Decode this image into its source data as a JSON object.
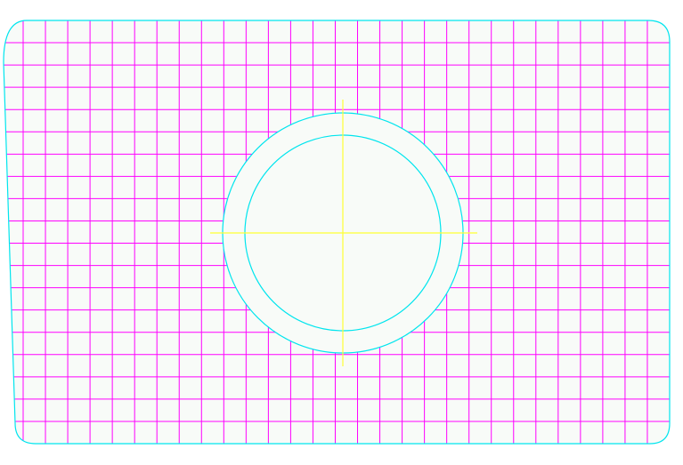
{
  "colors": {
    "background": "#ffffff",
    "panel_fill": "#f8fbf8",
    "grid_line": "#ff00ff",
    "outline": "#00e5ee",
    "centerline": "#ffff33"
  },
  "drawing": {
    "grid_columns": 29,
    "grid_rows": 19,
    "hole_count": 1,
    "hole_has_inner_ring": true,
    "hole_has_crosshair": true
  }
}
